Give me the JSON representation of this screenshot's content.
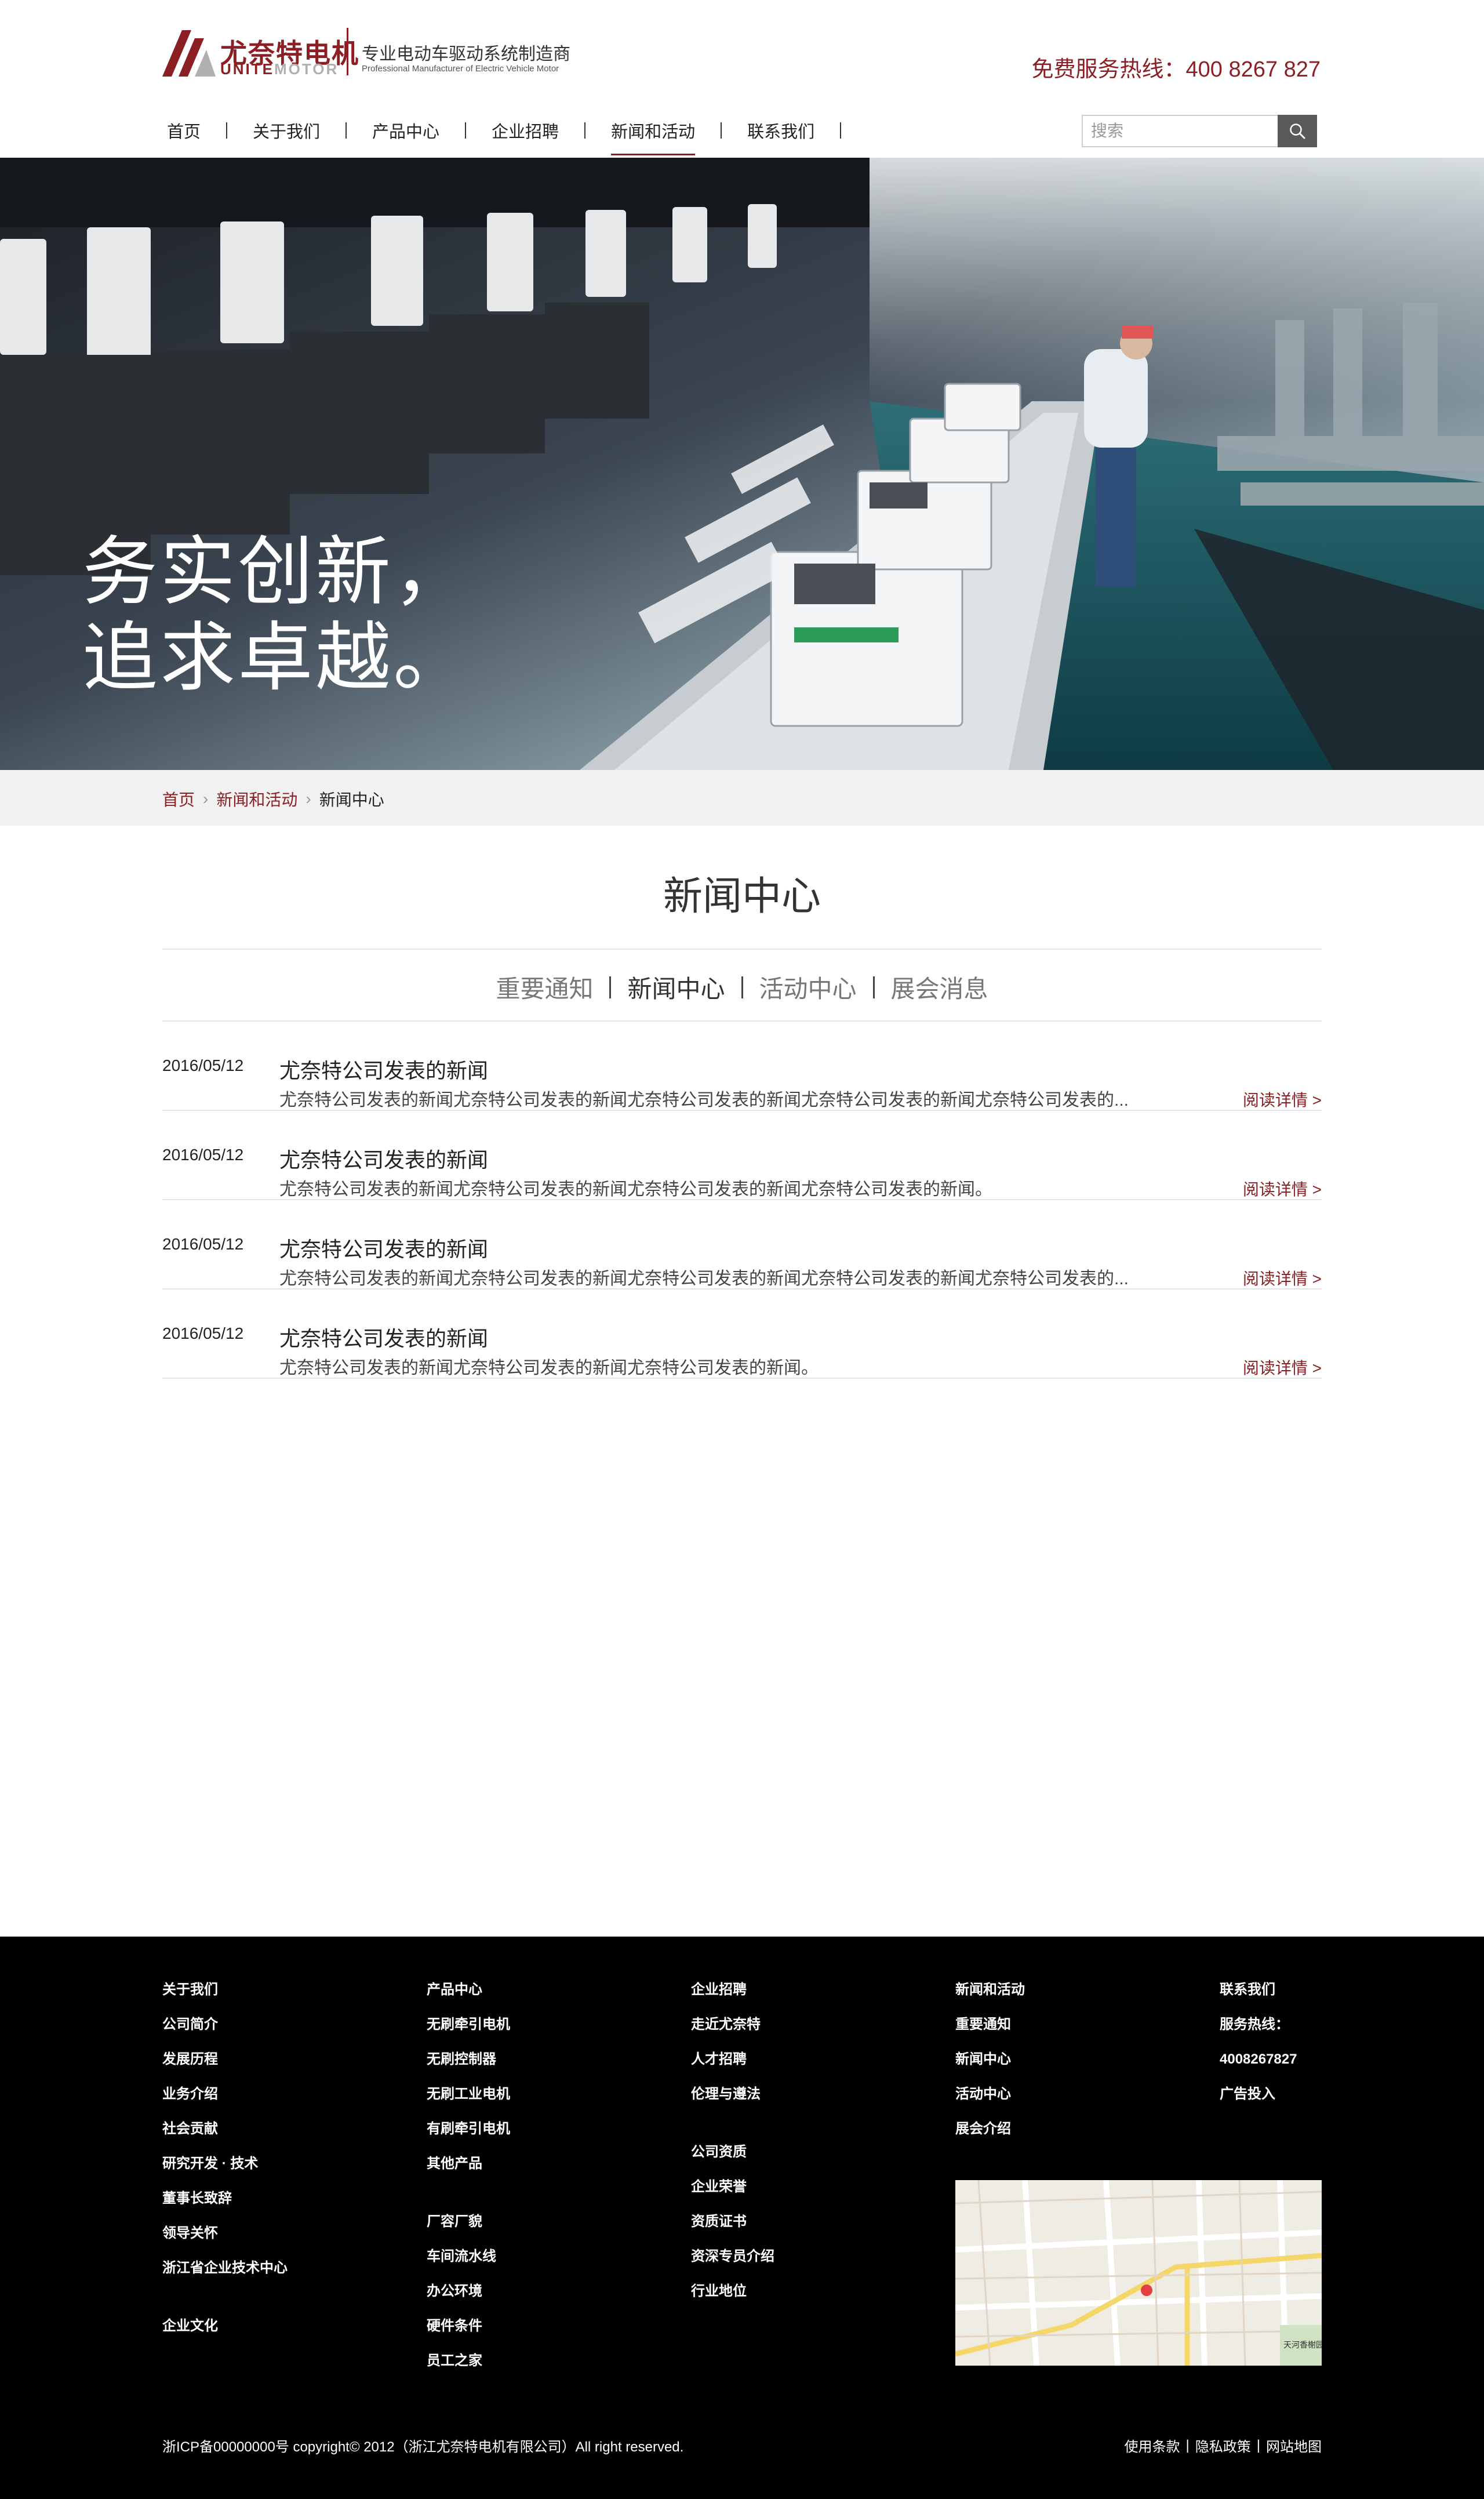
{
  "brand": {
    "name_cn": "尤奈特电机",
    "name_en_part1": "UNITE",
    "name_en_part2": "MOTOR",
    "slogan": "专业电动车驱动系统制造商",
    "slogan_en": "Professional Manufacturer of Electric Vehicle Motor",
    "color": "#8b1f24"
  },
  "header": {
    "hotline": "免费服务热线：400 8267 827"
  },
  "nav": {
    "items": [
      {
        "label": "首页"
      },
      {
        "label": "关于我们"
      },
      {
        "label": "产品中心"
      },
      {
        "label": "企业招聘"
      },
      {
        "label": "新闻和活动",
        "active": true
      },
      {
        "label": "联系我们"
      }
    ]
  },
  "search": {
    "placeholder": "搜索",
    "icon": "search-icon"
  },
  "banner": {
    "title": "务实创新，\n追求卓越。"
  },
  "breadcrumb": {
    "home": "首页",
    "section": "新闻和活动",
    "current": "新闻中心"
  },
  "main": {
    "title": "新闻中心",
    "tabs": [
      {
        "label": "重要通知"
      },
      {
        "label": "新闻中心",
        "active": true
      },
      {
        "label": "活动中心"
      },
      {
        "label": "展会消息"
      }
    ],
    "news": [
      {
        "date": "2016/05/12",
        "title": "尤奈特公司发表的新闻",
        "summary": "尤奈特公司发表的新闻尤奈特公司发表的新闻尤奈特公司发表的新闻尤奈特公司发表的新闻尤奈特公司发表的...",
        "more": "阅读详情 >"
      },
      {
        "date": "2016/05/12",
        "title": "尤奈特公司发表的新闻",
        "summary": "尤奈特公司发表的新闻尤奈特公司发表的新闻尤奈特公司发表的新闻尤奈特公司发表的新闻。",
        "more": "阅读详情 >"
      },
      {
        "date": "2016/05/12",
        "title": "尤奈特公司发表的新闻",
        "summary": "尤奈特公司发表的新闻尤奈特公司发表的新闻尤奈特公司发表的新闻尤奈特公司发表的新闻尤奈特公司发表的...",
        "more": "阅读详情 >"
      },
      {
        "date": "2016/05/12",
        "title": "尤奈特公司发表的新闻",
        "summary": "尤奈特公司发表的新闻尤奈特公司发表的新闻尤奈特公司发表的新闻。",
        "more": "阅读详情 >"
      }
    ]
  },
  "footer": {
    "columns": [
      {
        "groups": [
          [
            "关于我们",
            "公司简介",
            "发展历程",
            "业务介绍",
            "社会贡献",
            "研究开发 · 技术",
            "董事长致辞",
            "领导关怀",
            "浙江省企业技术中心"
          ],
          [
            "企业文化"
          ]
        ]
      },
      {
        "groups": [
          [
            "产品中心",
            "无刷牵引电机",
            "无刷控制器",
            "无刷工业电机",
            "有刷牵引电机",
            "其他产品"
          ],
          [
            "厂容厂貌",
            "车间流水线",
            "办公环境",
            "硬件条件",
            "员工之家"
          ]
        ]
      },
      {
        "groups": [
          [
            "企业招聘",
            "走近尤奈特",
            "人才招聘",
            "伦理与遵法"
          ],
          [
            "公司资质",
            "企业荣誉",
            "资质证书",
            "资深专员介绍",
            "行业地位"
          ]
        ]
      },
      {
        "groups": [
          [
            "新闻和活动",
            "重要通知",
            "新闻中心",
            "活动中心",
            "展会介绍"
          ]
        ]
      },
      {
        "groups": [
          [
            "联系我们",
            "服务热线：",
            "4008267827"
          ],
          [
            "广告投入"
          ]
        ]
      }
    ],
    "map_label": "天河香榭园",
    "copyright": "浙ICP备00000000号 copyright© 2012（浙江尤奈特电机有限公司）All right reserved.",
    "links": [
      "使用条款",
      "隐私政策",
      "网站地图"
    ]
  }
}
